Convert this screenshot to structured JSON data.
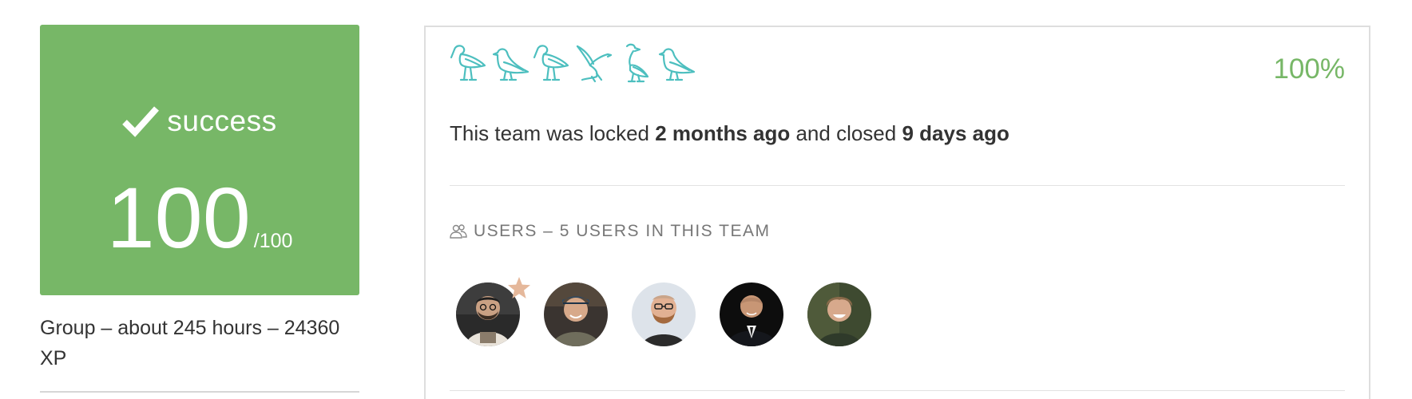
{
  "score_card": {
    "status_icon": "check-icon",
    "status_label": "success",
    "score": "100",
    "max_score": "/100",
    "background_color": "#77b767"
  },
  "group_info": "Group – about 245 hours – 24360 XP",
  "team": {
    "bird_icons": [
      "ibis-icon",
      "bird-icon",
      "ibis-icon",
      "flying-bird-icon",
      "heron-icon",
      "bird-icon"
    ],
    "bird_color": "#4dbfbf",
    "progress": "100%",
    "progress_color": "#77b767",
    "lock_prefix": "This team was locked",
    "locked_ago": "2 months ago",
    "lock_middle": "and closed",
    "closed_ago": "9 days ago",
    "users_heading": "USERS – 5 USERS IN THIS TEAM",
    "users_icon": "users-icon",
    "leader_marker": "star-icon",
    "avatars": [
      {
        "name": "user-avatar-1",
        "leader": true
      },
      {
        "name": "user-avatar-2",
        "leader": false
      },
      {
        "name": "user-avatar-3",
        "leader": false
      },
      {
        "name": "user-avatar-4",
        "leader": false
      },
      {
        "name": "user-avatar-5",
        "leader": false
      }
    ]
  }
}
